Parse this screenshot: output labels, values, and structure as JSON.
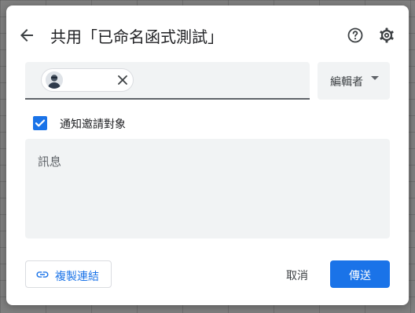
{
  "dialog": {
    "title": "共用「已命名函式測試」",
    "back_icon": "arrow-left-icon",
    "help_icon": "help-circle-icon",
    "settings_icon": "gear-icon"
  },
  "recipients": {
    "chip_avatar_icon": "user-avatar-icon",
    "chip_remove_icon": "close-icon"
  },
  "role": {
    "selected": "編輯者",
    "caret_icon": "caret-down-icon"
  },
  "notify": {
    "label": "通知邀請對象",
    "checked": true
  },
  "message": {
    "placeholder": "訊息"
  },
  "footer": {
    "copy_link_label": "複製連結",
    "copy_link_icon": "link-icon",
    "cancel_label": "取消",
    "send_label": "傳送"
  },
  "colors": {
    "accent": "#1a73e8",
    "field_bg": "#f1f3f4",
    "text": "#202124"
  }
}
